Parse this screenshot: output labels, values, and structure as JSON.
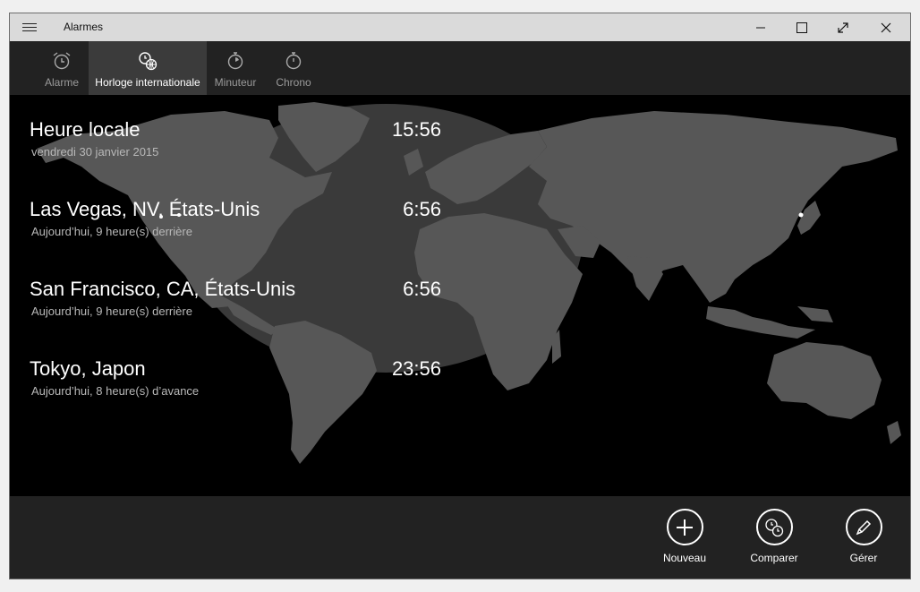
{
  "window": {
    "title": "Alarmes"
  },
  "tabs": [
    {
      "label": "Alarme",
      "icon": "alarm-clock-icon"
    },
    {
      "label": "Horloge internationale",
      "icon": "world-clock-icon",
      "active": true
    },
    {
      "label": "Minuteur",
      "icon": "timer-icon"
    },
    {
      "label": "Chrono",
      "icon": "stopwatch-icon"
    }
  ],
  "clocks": [
    {
      "city": "Heure locale",
      "time": "15:56",
      "sub": "vendredi 30 janvier 2015"
    },
    {
      "city": "Las Vegas, NV, États-Unis",
      "time": "6:56",
      "sub": "Aujourd’hui, 9 heure(s) derrière"
    },
    {
      "city": "San Francisco, CA, États-Unis",
      "time": "6:56",
      "sub": "Aujourd’hui, 9 heure(s) derrière"
    },
    {
      "city": "Tokyo, Japon",
      "time": "23:56",
      "sub": "Aujourd’hui, 8 heure(s) d’avance"
    }
  ],
  "appbar": {
    "new_label": "Nouveau",
    "compare_label": "Comparer",
    "manage_label": "Gérer"
  },
  "colors": {
    "land": "#575757",
    "daylight": "#3a3a3a",
    "background": "#000000",
    "bar": "#222222"
  }
}
